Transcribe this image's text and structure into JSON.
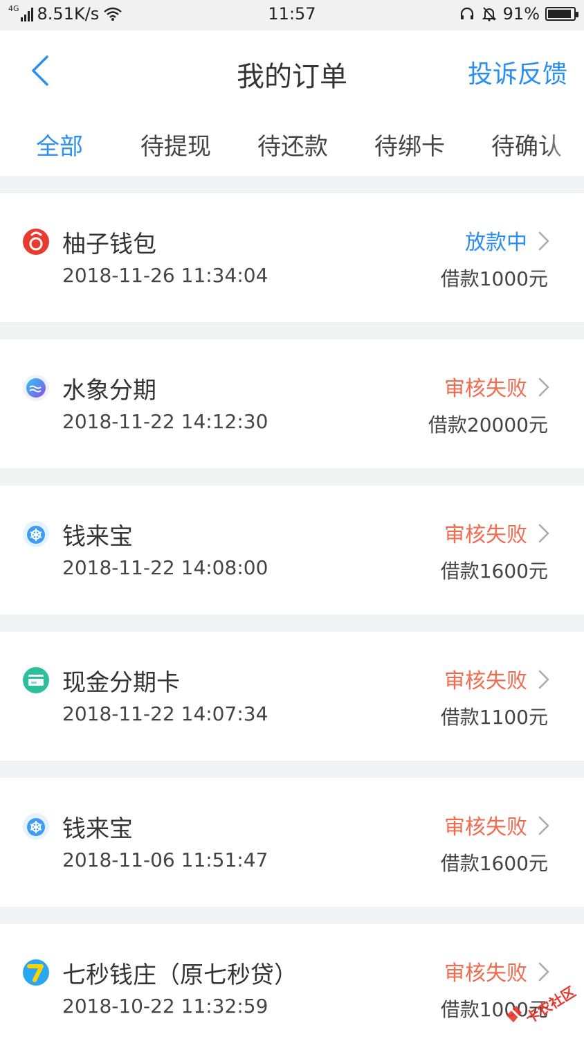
{
  "status_bar": {
    "network_type": "4G",
    "net_speed": "8.51K/s",
    "time": "11:57",
    "battery_percent": "91%",
    "battery_level": 0.91
  },
  "header": {
    "title": "我的订单",
    "right_action": "投诉反馈"
  },
  "tabs": [
    {
      "label": "全部",
      "active": true
    },
    {
      "label": "待提现",
      "active": false
    },
    {
      "label": "待还款",
      "active": false
    },
    {
      "label": "待绑卡",
      "active": false
    },
    {
      "label": "待确认",
      "active": false
    }
  ],
  "colors": {
    "accent": "#2a8ff0",
    "status_processing": "#2a8ff0",
    "status_failed": "#f26b4f"
  },
  "orders": [
    {
      "name": "柚子钱包",
      "time": "2018-11-26 11:34:04",
      "status": "放款中",
      "status_type": "processing",
      "amount": "借款1000元",
      "icon": "youzi-logo-icon"
    },
    {
      "name": "水象分期",
      "time": "2018-11-22 14:12:30",
      "status": "审核失败",
      "status_type": "failed",
      "amount": "借款20000元",
      "icon": "shuixiang-logo-icon"
    },
    {
      "name": "钱来宝",
      "time": "2018-11-22 14:08:00",
      "status": "审核失败",
      "status_type": "failed",
      "amount": "借款1600元",
      "icon": "qianlaibao-logo-icon"
    },
    {
      "name": "现金分期卡",
      "time": "2018-11-22 14:07:34",
      "status": "审核失败",
      "status_type": "failed",
      "amount": "借款1100元",
      "icon": "xianjin-card-logo-icon"
    },
    {
      "name": "钱来宝",
      "time": "2018-11-06 11:51:47",
      "status": "审核失败",
      "status_type": "failed",
      "amount": "借款1600元",
      "icon": "qianlaibao-logo-icon"
    },
    {
      "name": "七秒钱庄（原七秒贷）",
      "time": "2018-10-22 11:32:59",
      "status": "审核失败",
      "status_type": "failed",
      "amount": "借款1000元",
      "icon": "qimiao-logo-icon"
    }
  ],
  "watermark": {
    "text": "卡农社区"
  }
}
